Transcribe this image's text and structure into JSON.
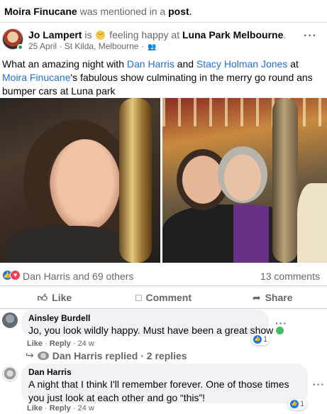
{
  "notice": {
    "name": "Moira Finucane",
    "middle": " was mentioned in a ",
    "link": "post",
    "end": "."
  },
  "post": {
    "author": "Jo Lampert",
    "activity": " is ",
    "feeling": " feeling happy at ",
    "place": "Luna Park Melbourne",
    "period": ".",
    "meta": "25 April · St Kilda, Melbourne ·",
    "globe_icon": "friends-icon",
    "more": "···",
    "caption": {
      "p1": "What an amazing night with ",
      "tag1": "Dan Harris",
      "p2": " and ",
      "tag2": "Stacy Holman Jones",
      "p3": " at ",
      "tag3": "Moira Finucane",
      "p4": "'s fabulous show culminating in the merry go round ans bumper cars at Luna park"
    },
    "photos": [
      "selfie-with-carousel-pole",
      "two-friends-on-carousel"
    ]
  },
  "reactions": {
    "icons": [
      "like",
      "love"
    ],
    "summary": "Dan Harris and 69 others",
    "comments": "13 comments"
  },
  "actions": {
    "like": "Like",
    "comment": "Comment",
    "share": "Share"
  },
  "comments": [
    {
      "author": "Ainsley Burdell",
      "text": "Jo, you look wildly happy. Must have been a great show",
      "reaction_count": "1",
      "like": "Like",
      "reply": "Reply",
      "age": "24 w",
      "more": "···"
    },
    {
      "author": "Dan Harris",
      "text": "A night that I think I'll remember forever. One of those times you just look at each other and go “this”!",
      "reaction_count": "1",
      "like": "Like",
      "reply": "Reply",
      "age": "24 w",
      "more": "···"
    }
  ],
  "replies": {
    "author": "Dan Harris",
    "verb": " replied · ",
    "count": "2 replies"
  },
  "colors": {
    "link": "#216fdb",
    "muted": "#65676b",
    "like_blue": "#1877f2",
    "love_red": "#f33e58",
    "bubble": "#f0f2f5"
  }
}
